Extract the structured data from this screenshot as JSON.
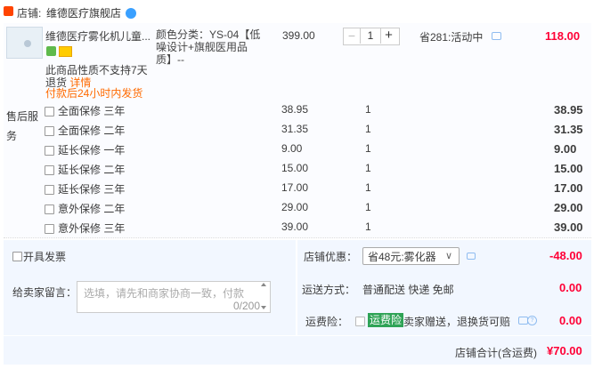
{
  "shop": {
    "label": "店铺:",
    "name": "维德医疗旗舰店"
  },
  "item": {
    "title": "维德医疗雾化机儿童...",
    "sku": "颜色分类：YS-04【低噪设计+旗舰医用品质】--",
    "unit_price": "399.00",
    "quantity": "1",
    "promo": "省281:活动中",
    "total": "118.00",
    "note_no_return": "此商品性质不支持7天",
    "note_return_prefix": "退货",
    "note_detail_link": "详情",
    "note_ship": "付款后24小时内发货"
  },
  "services": {
    "label": "售后服务",
    "rows": [
      {
        "name": "全面保修 三年",
        "price": "38.95",
        "qty": "1",
        "total": "38.95"
      },
      {
        "name": "全面保修 二年",
        "price": "31.35",
        "qty": "1",
        "total": "31.35"
      },
      {
        "name": "延长保修 一年",
        "price": "9.00",
        "qty": "1",
        "total": "9.00"
      },
      {
        "name": "延长保修 二年",
        "price": "15.00",
        "qty": "1",
        "total": "15.00"
      },
      {
        "name": "延长保修 三年",
        "price": "17.00",
        "qty": "1",
        "total": "17.00"
      },
      {
        "name": "意外保修 二年",
        "price": "29.00",
        "qty": "1",
        "total": "29.00"
      },
      {
        "name": "意外保修 三年",
        "price": "39.00",
        "qty": "1",
        "total": "39.00"
      }
    ]
  },
  "invoice": {
    "label": "开具发票"
  },
  "message": {
    "label": "给卖家留言：",
    "placeholder": "选填，请先和商家协商一致，付款",
    "counter": "0/200"
  },
  "discount": {
    "label": "店铺优惠：",
    "selected": "省48元:雾化器",
    "amount": "-48.00"
  },
  "shipping": {
    "label": "运送方式：",
    "method": "普通配送 快递 免邮",
    "amount": "0.00"
  },
  "insurance": {
    "label": "运费险：",
    "badge": "运费险",
    "desc": "卖家赠送，退换货可赔",
    "amount": "0.00"
  },
  "footer": {
    "total_label": "店铺合计(含运费)",
    "total_amount": "¥70.00"
  }
}
